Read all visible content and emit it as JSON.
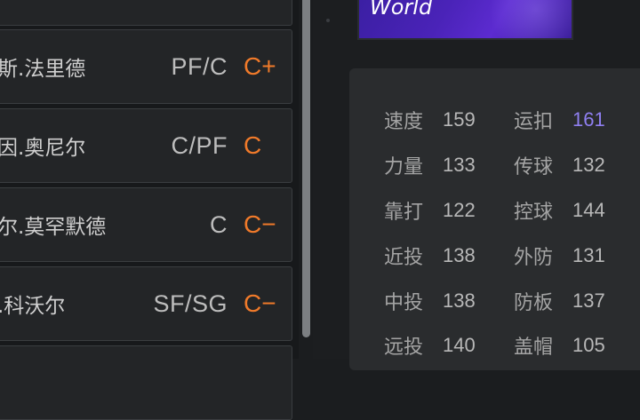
{
  "players": [
    {
      "name": "斯.法里德",
      "position": "PF/C",
      "grade": "C+"
    },
    {
      "name": "因.奥尼尔",
      "position": "C/PF",
      "grade": "C"
    },
    {
      "name": "尔.莫罕默德",
      "position": "C",
      "grade": "C−"
    },
    {
      "name": ".科沃尔",
      "position": "SF/SG",
      "grade": "C−"
    }
  ],
  "banner": {
    "title": "World"
  },
  "stats": {
    "left": [
      {
        "label": "速度",
        "value": "159"
      },
      {
        "label": "力量",
        "value": "133"
      },
      {
        "label": "靠打",
        "value": "122"
      },
      {
        "label": "近投",
        "value": "138"
      },
      {
        "label": "中投",
        "value": "138"
      },
      {
        "label": "远投",
        "value": "140"
      }
    ],
    "right": [
      {
        "label": "运扣",
        "value": "161"
      },
      {
        "label": "传球",
        "value": "132"
      },
      {
        "label": "控球",
        "value": "144"
      },
      {
        "label": "外防",
        "value": "131"
      },
      {
        "label": "防板",
        "value": "137"
      },
      {
        "label": "盖帽",
        "value": "105"
      }
    ]
  },
  "colors": {
    "grade": "#f07a2a",
    "highlight_value": "#8f7ff0",
    "banner": "#4a23b8"
  }
}
